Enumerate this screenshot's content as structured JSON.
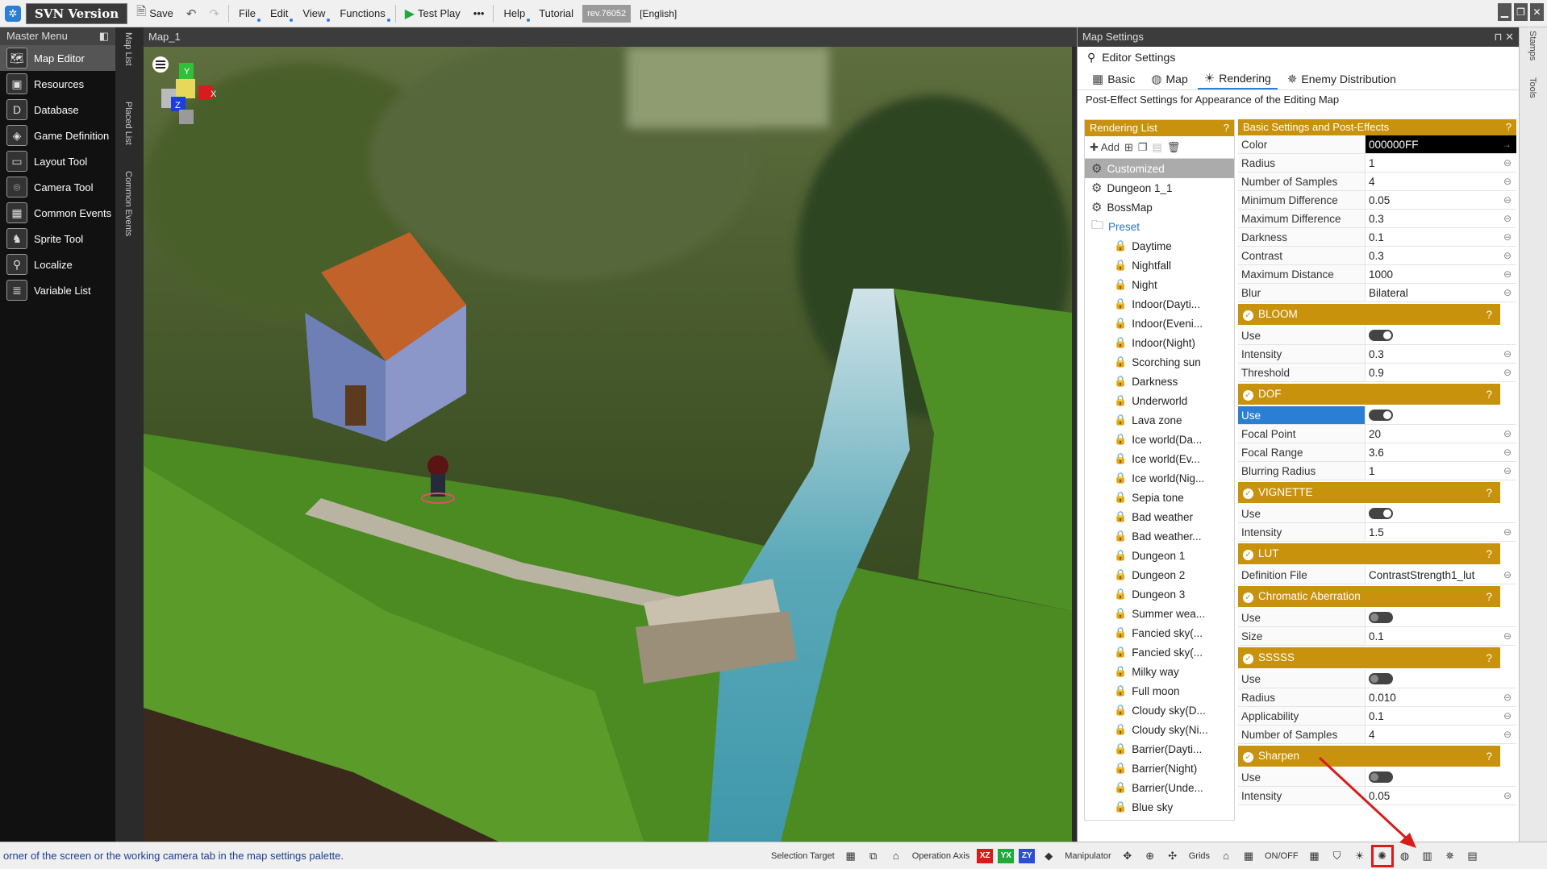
{
  "menubar": {
    "svn_label": "SVN Version",
    "save_label": "Save",
    "menus": [
      "File",
      "Edit",
      "View",
      "Functions"
    ],
    "test_play_label": "Test Play",
    "more_label": "•••",
    "help_label": "Help",
    "tutorial_label": "Tutorial",
    "revision": "rev.76052",
    "language": "[English]"
  },
  "master_menu": {
    "title": "Master Menu",
    "items": [
      {
        "label": "Map Editor",
        "icon": "map-icon"
      },
      {
        "label": "Resources",
        "icon": "resources-icon"
      },
      {
        "label": "Database",
        "icon": "database-icon"
      },
      {
        "label": "Game Definition",
        "icon": "game-definition-icon"
      },
      {
        "label": "Layout Tool",
        "icon": "layout-icon"
      },
      {
        "label": "Camera Tool",
        "icon": "camera-icon"
      },
      {
        "label": "Common Events",
        "icon": "common-events-icon"
      },
      {
        "label": "Sprite Tool",
        "icon": "sprite-icon"
      },
      {
        "label": "Localize",
        "icon": "localize-icon"
      },
      {
        "label": "Variable List",
        "icon": "variable-list-icon"
      }
    ]
  },
  "side_tabs": [
    "Map List",
    "Placed List",
    "Common Events"
  ],
  "right_tabs": [
    "Stamps",
    "Tools"
  ],
  "map": {
    "title": "Map_1",
    "gizmo": {
      "y": "Y",
      "x": "X",
      "z": "Z"
    }
  },
  "settings": {
    "title": "Map Settings",
    "editor_settings": "Editor Settings",
    "tabs": [
      "Basic",
      "Map",
      "Rendering",
      "Enemy Distribution"
    ],
    "description": "Post-Effect Settings for Appearance of the Editing Map",
    "rendering_list": {
      "title": "Rendering List",
      "help": "?",
      "add_label": "Add",
      "custom_items": [
        "Customized",
        "Dungeon 1_1",
        "BossMap"
      ],
      "preset_label": "Preset",
      "presets": [
        "Daytime",
        "Nightfall",
        "Night",
        "Indoor(Dayti...",
        "Indoor(Eveni...",
        "Indoor(Night)",
        "Scorching sun",
        "Darkness",
        "Underworld",
        "Lava zone",
        "Ice world(Da...",
        "Ice world(Ev...",
        "Ice world(Nig...",
        "Sepia tone",
        "Bad weather",
        "Bad weather...",
        "Dungeon 1",
        "Dungeon 2",
        "Dungeon 3",
        "Summer wea...",
        "Fancied sky(...",
        "Fancied sky(...",
        "Milky way",
        "Full moon",
        "Cloudy sky(D...",
        "Cloudy sky(Ni...",
        "Barrier(Dayti...",
        "Barrier(Night)",
        "Barrier(Unde...",
        "Blue sky"
      ]
    },
    "basic": {
      "title": "Basic Settings and Post-Effects",
      "help": "?",
      "rows": [
        {
          "k": "Color",
          "v": "000000FF"
        },
        {
          "k": "Radius",
          "v": "1"
        },
        {
          "k": "Number of Samples",
          "v": "4"
        },
        {
          "k": "Minimum Difference",
          "v": "0.05"
        },
        {
          "k": "Maximum Difference",
          "v": "0.3"
        },
        {
          "k": "Darkness",
          "v": "0.1"
        },
        {
          "k": "Contrast",
          "v": "0.3"
        },
        {
          "k": "Maximum Distance",
          "v": "1000"
        },
        {
          "k": "Blur",
          "v": "Bilateral"
        }
      ]
    },
    "bloom": {
      "title": "BLOOM",
      "use": "Use",
      "rows": [
        {
          "k": "Intensity",
          "v": "0.3"
        },
        {
          "k": "Threshold",
          "v": "0.9"
        }
      ]
    },
    "dof": {
      "title": "DOF",
      "use": "Use",
      "rows": [
        {
          "k": "Focal Point",
          "v": "20"
        },
        {
          "k": "Focal Range",
          "v": "3.6"
        },
        {
          "k": "Blurring Radius",
          "v": "1"
        }
      ]
    },
    "vignette": {
      "title": "VIGNETTE",
      "use": "Use",
      "rows": [
        {
          "k": "Intensity",
          "v": "1.5"
        }
      ]
    },
    "lut": {
      "title": "LUT",
      "rows": [
        {
          "k": "Definition File",
          "v": "ContrastStrength1_lut"
        }
      ]
    },
    "chromatic": {
      "title": "Chromatic Aberration",
      "use": "Use",
      "rows": [
        {
          "k": "Size",
          "v": "0.1"
        }
      ]
    },
    "sssss": {
      "title": "SSSSS",
      "use": "Use",
      "rows": [
        {
          "k": "Radius",
          "v": "0.010"
        },
        {
          "k": "Applicability",
          "v": "0.1"
        },
        {
          "k": "Number of Samples",
          "v": "4"
        }
      ]
    },
    "sharpen": {
      "title": "Sharpen",
      "use": "Use",
      "rows": [
        {
          "k": "Intensity",
          "v": "0.05"
        }
      ]
    }
  },
  "status": {
    "message": "orner of the screen or the working camera tab in the map settings palette.",
    "selection_target": "Selection Target",
    "operation_axis": "Operation Axis",
    "axes": [
      "XZ",
      "YX",
      "ZY"
    ],
    "manipulator": "Manipulator",
    "grids": "Grids",
    "onoff": "ON/OFF"
  },
  "colors": {
    "gold": "#c8920c",
    "accent": "#2a7fd4",
    "highlight": "#d81b1b"
  }
}
